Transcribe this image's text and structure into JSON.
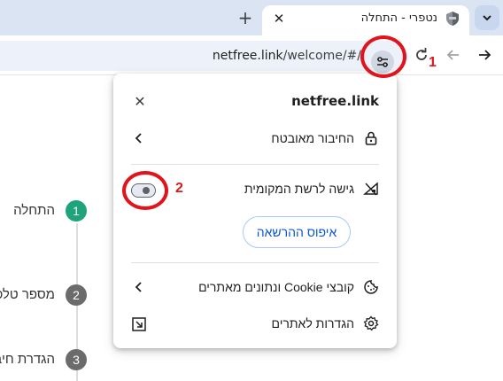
{
  "browser": {
    "tab": {
      "title": "נטפרי - התחלה",
      "close_symbol": "✕",
      "favicon": "shield-icon"
    },
    "new_tab_symbol": "+",
    "address": {
      "host": "netfree.link",
      "path": "/welcome/#/"
    }
  },
  "annotations": {
    "marker_1": "1",
    "marker_2": "2",
    "color": "#e0141c"
  },
  "page": {
    "steps": [
      {
        "number": "1",
        "label": "התחלה",
        "color": "#1fa37a"
      },
      {
        "number": "2",
        "label": "מספר טלפ",
        "color": "#6b6b6b"
      },
      {
        "number": "3",
        "label": "הגדרת חיב",
        "color": "#6b6b6b"
      }
    ]
  },
  "popup": {
    "title": "netfree.link",
    "close_symbol": "✕",
    "secure_connection": {
      "label": "החיבור מאובטח",
      "icon": "lock-icon"
    },
    "local_network": {
      "label": "גישה לרשת המקומית",
      "icon": "local-network-icon",
      "toggle": "off"
    },
    "reset_button": "איפוס ההרשאה",
    "cookies": {
      "label": "קובצי Cookie ונתונים מאתרים",
      "icon": "cookie-icon"
    },
    "site_settings": {
      "label": "הגדרות לאתרים",
      "icon": "gear-icon"
    },
    "accent_color": "#0b57d0"
  }
}
